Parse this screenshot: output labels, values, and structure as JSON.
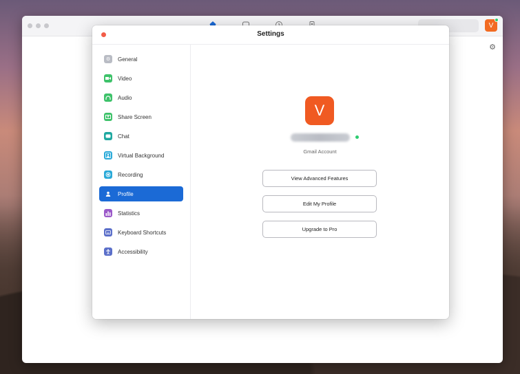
{
  "settings": {
    "title": "Settings",
    "sidebar": {
      "items": [
        {
          "label": "General",
          "icon": "gear-icon",
          "color": "#b9bcc4"
        },
        {
          "label": "Video",
          "icon": "video-camera-icon",
          "color": "#3ec26a"
        },
        {
          "label": "Audio",
          "icon": "headphones-icon",
          "color": "#3ec26a"
        },
        {
          "label": "Share Screen",
          "icon": "share-screen-icon",
          "color": "#3ec26a"
        },
        {
          "label": "Chat",
          "icon": "chat-bubble-icon",
          "color": "#1fa8a0"
        },
        {
          "label": "Virtual Background",
          "icon": "person-background-icon",
          "color": "#29a9d8"
        },
        {
          "label": "Recording",
          "icon": "record-icon",
          "color": "#29a9d8"
        },
        {
          "label": "Profile",
          "icon": "person-icon",
          "color": "#1b6ad6",
          "active": true
        },
        {
          "label": "Statistics",
          "icon": "bar-chart-icon",
          "color": "#9b59c9"
        },
        {
          "label": "Keyboard Shortcuts",
          "icon": "keyboard-icon",
          "color": "#5b6fc9"
        },
        {
          "label": "Accessibility",
          "icon": "accessibility-icon",
          "color": "#5b6fc9"
        }
      ]
    },
    "profile": {
      "avatar_letter": "V",
      "account_type": "Gmail Account",
      "buttons": {
        "advanced": "View Advanced Features",
        "edit": "Edit My Profile",
        "upgrade": "Upgrade to Pro"
      }
    }
  },
  "main_window": {
    "avatar_letter": "V"
  },
  "colors": {
    "accent": "#1b6ad6",
    "avatar": "#f05a22",
    "online": "#2ecc71",
    "close": "#f25c47"
  }
}
